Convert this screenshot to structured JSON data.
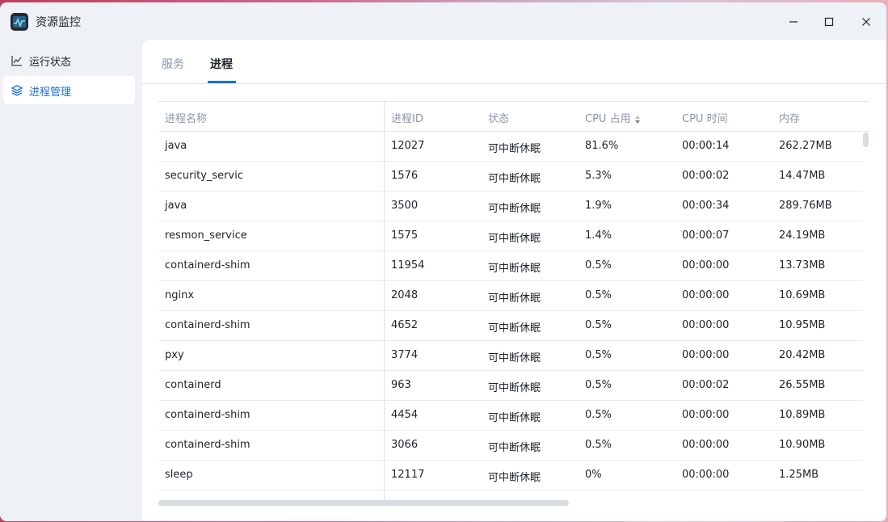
{
  "app": {
    "title": "资源监控"
  },
  "sidebar": {
    "items": [
      {
        "label": "运行状态"
      },
      {
        "label": "进程管理"
      }
    ]
  },
  "tabs": [
    {
      "label": "服务"
    },
    {
      "label": "进程"
    }
  ],
  "table": {
    "columns": [
      "进程名称",
      "进程ID",
      "状态",
      "CPU 占用",
      "CPU 时间",
      "内存"
    ],
    "rows": [
      [
        "java",
        "12027",
        "可中断休眠",
        "81.6%",
        "00:00:14",
        "262.27MB"
      ],
      [
        "security_servic",
        "1576",
        "可中断休眠",
        "5.3%",
        "00:00:02",
        "14.47MB"
      ],
      [
        "java",
        "3500",
        "可中断休眠",
        "1.9%",
        "00:00:34",
        "289.76MB"
      ],
      [
        "resmon_service",
        "1575",
        "可中断休眠",
        "1.4%",
        "00:00:07",
        "24.19MB"
      ],
      [
        "containerd-shim",
        "11954",
        "可中断休眠",
        "0.5%",
        "00:00:00",
        "13.73MB"
      ],
      [
        "nginx",
        "2048",
        "可中断休眠",
        "0.5%",
        "00:00:00",
        "10.69MB"
      ],
      [
        "containerd-shim",
        "4652",
        "可中断休眠",
        "0.5%",
        "00:00:00",
        "10.95MB"
      ],
      [
        "pxy",
        "3774",
        "可中断休眠",
        "0.5%",
        "00:00:00",
        "20.42MB"
      ],
      [
        "containerd",
        "963",
        "可中断休眠",
        "0.5%",
        "00:00:02",
        "26.55MB"
      ],
      [
        "containerd-shim",
        "4454",
        "可中断休眠",
        "0.5%",
        "00:00:00",
        "10.89MB"
      ],
      [
        "containerd-shim",
        "3066",
        "可中断休眠",
        "0.5%",
        "00:00:00",
        "10.90MB"
      ],
      [
        "sleep",
        "12117",
        "可中断休眠",
        "0%",
        "00:00:00",
        "1.25MB"
      ]
    ]
  },
  "colors": {
    "accent": "#1e6fdc",
    "muted": "#8a96a8"
  },
  "icons": {
    "app": "resource-monitor-icon",
    "nav_status": "line-chart-icon",
    "nav_process": "layers-icon",
    "sort": "sort-icon"
  }
}
